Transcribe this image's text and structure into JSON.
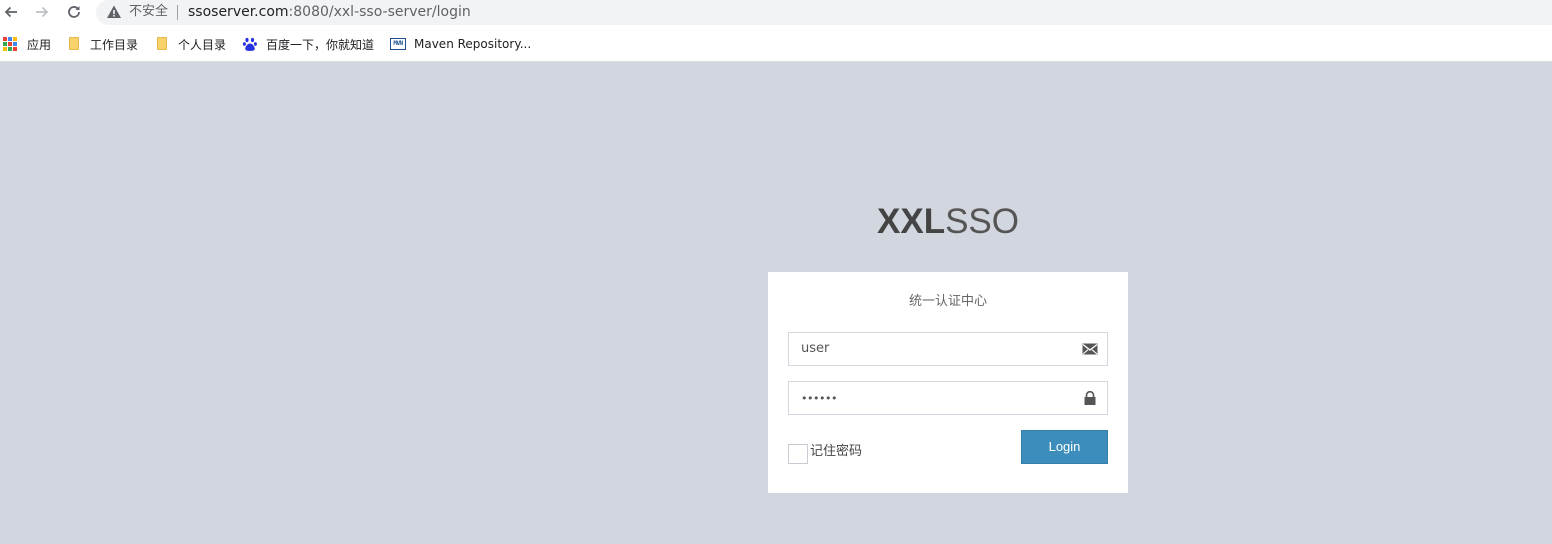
{
  "browser": {
    "security_label": "不安全",
    "url_host": "ssoserver.com",
    "url_rest": ":8080/xxl-sso-server/login",
    "icons": [
      "back-arrow-icon",
      "forward-arrow-icon",
      "reload-icon",
      "warning-icon"
    ]
  },
  "bookmarks": [
    {
      "label": "应用",
      "icon": "apps-grid-icon"
    },
    {
      "label": "工作目录",
      "icon": "folder-icon"
    },
    {
      "label": "个人目录",
      "icon": "folder-icon"
    },
    {
      "label": "百度一下，你就知道",
      "icon": "baidu-paw-icon"
    },
    {
      "label": "Maven Repository...",
      "icon": "maven-icon",
      "icon_text": "MVN"
    }
  ],
  "login": {
    "logo_bold": "XXL",
    "logo_light": "SSO",
    "box_message": "统一认证中心",
    "username_value": "user",
    "password_value": "••••••",
    "remember_label": "记住密码",
    "remember_checked": false,
    "login_button": "Login"
  },
  "colors": {
    "page_background": "#d2d6de",
    "primary_button": "#3c8dbc",
    "box_background": "#ffffff"
  }
}
